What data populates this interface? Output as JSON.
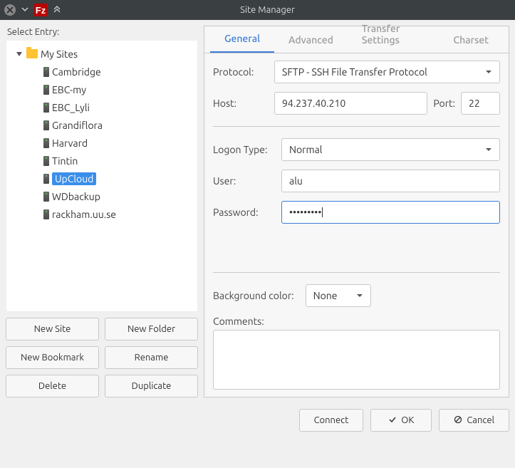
{
  "titlebar": {
    "title": "Site Manager",
    "app_icon_text": "Fz"
  },
  "left": {
    "select_entry_label": "Select Entry:",
    "root_label": "My Sites",
    "sites": [
      {
        "label": "Cambridge",
        "selected": false
      },
      {
        "label": "EBC-my",
        "selected": false
      },
      {
        "label": "EBC_Lyli",
        "selected": false
      },
      {
        "label": "Grandiflora",
        "selected": false
      },
      {
        "label": "Harvard",
        "selected": false
      },
      {
        "label": "Tintin",
        "selected": false
      },
      {
        "label": "UpCloud",
        "selected": true
      },
      {
        "label": "WDbackup",
        "selected": false
      },
      {
        "label": "rackham.uu.se",
        "selected": false
      }
    ],
    "buttons": {
      "new_site": "New Site",
      "new_folder": "New Folder",
      "new_bookmark": "New Bookmark",
      "rename": "Rename",
      "delete": "Delete",
      "duplicate": "Duplicate"
    }
  },
  "tabs": {
    "general": "General",
    "advanced": "Advanced",
    "transfer_settings": "Transfer Settings",
    "charset": "Charset"
  },
  "form": {
    "protocol_label": "Protocol:",
    "protocol_value": "SFTP - SSH File Transfer Protocol",
    "host_label": "Host:",
    "host_value": "94.237.40.210",
    "port_label": "Port:",
    "port_value": "22",
    "logon_type_label": "Logon Type:",
    "logon_type_value": "Normal",
    "user_label": "User:",
    "user_value": "alu",
    "password_label": "Password:",
    "password_value": "•••••••••",
    "bgcolor_label": "Background color:",
    "bgcolor_value": "None",
    "comments_label": "Comments:",
    "comments_value": ""
  },
  "bottom": {
    "connect": "Connect",
    "ok": "OK",
    "cancel": "Cancel"
  }
}
